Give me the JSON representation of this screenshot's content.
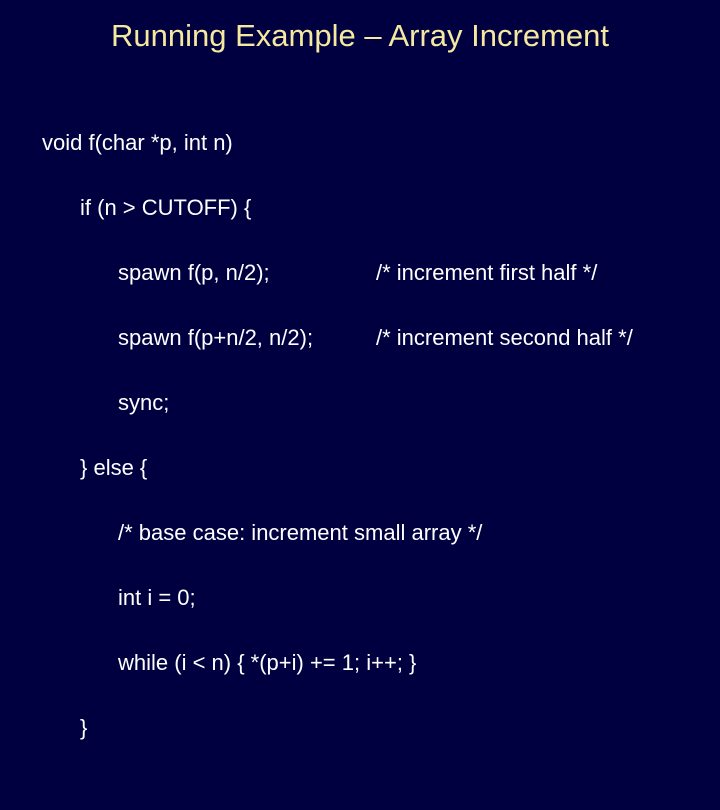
{
  "slide": {
    "title": "Running Example – Array Increment",
    "code": {
      "l1": "void f(char *p, int n)",
      "l2": "if (n > CUTOFF) {",
      "l3_call": "spawn f(p, n/2);",
      "l3_comment": "/* increment first half */",
      "l4_call": "spawn f(p+n/2, n/2);",
      "l4_comment": "/* increment second half */",
      "l5": "sync;",
      "l6": "} else {",
      "l7": "/* base case: increment small array */",
      "l8": "int i = 0;",
      "l9": "while (i < n) { *(p+i) += 1; i++; }",
      "l10": "}"
    }
  }
}
